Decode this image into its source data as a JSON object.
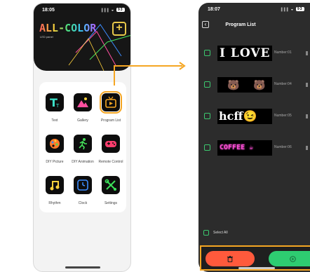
{
  "left_screen": {
    "status": {
      "time": "18:05",
      "signal": "∥∥∥ ◒",
      "battery": "93"
    },
    "brand": {
      "name": "ALL-COLOR",
      "subtitle": "LED panel"
    },
    "menu": [
      {
        "label": "Text",
        "icon": "text-icon",
        "color": "#3ce0c8"
      },
      {
        "label": "Gallery",
        "icon": "gallery-icon",
        "color": "#ff4fa0"
      },
      {
        "label": "Program List",
        "icon": "tv-icon",
        "color": "#f5a623",
        "selected": true
      },
      {
        "label": "DIY Picture",
        "icon": "palette-icon",
        "color": "#ff7a2a"
      },
      {
        "label": "DIY Animation",
        "icon": "runner-icon",
        "color": "#44e05a"
      },
      {
        "label": "Remote Control",
        "icon": "gamepad-icon",
        "color": "#ff3d6e"
      },
      {
        "label": "Rhythm",
        "icon": "music-icon",
        "color": "#ffd23c"
      },
      {
        "label": "Clock",
        "icon": "clock-icon",
        "color": "#3c8cff"
      },
      {
        "label": "Settings",
        "icon": "tools-icon",
        "color": "#3ce05a"
      }
    ]
  },
  "right_screen": {
    "status": {
      "time": "18:07",
      "signal": "∥∥∥ ◒",
      "battery": "93"
    },
    "title": "Program List",
    "programs": [
      {
        "preview_text": "I LOVE Y",
        "number": "Number:01"
      },
      {
        "preview_text": "🐻 🐻",
        "number": "Number:04"
      },
      {
        "preview_text": "hcff😉",
        "number": "Number:05"
      },
      {
        "preview_text": "COFFEE ☕",
        "number": "Number:06"
      }
    ],
    "select_all_label": "Select All"
  },
  "colors": {
    "accent": "#f5a623",
    "check_green": "#3cc86e",
    "delete_red": "#ff5a3c",
    "play_green": "#2ecc71"
  }
}
